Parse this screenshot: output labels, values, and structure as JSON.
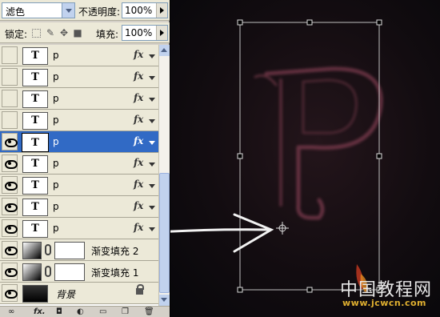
{
  "blend": {
    "mode": "滤色",
    "opacity_label": "不透明度:",
    "opacity_value": "100%"
  },
  "lock": {
    "label": "锁定:",
    "fill_label": "填充:",
    "fill_value": "100%"
  },
  "layers": [
    {
      "name": "p",
      "visible": false,
      "selected": false,
      "type": "text"
    },
    {
      "name": "p",
      "visible": false,
      "selected": false,
      "type": "text"
    },
    {
      "name": "p",
      "visible": false,
      "selected": false,
      "type": "text"
    },
    {
      "name": "p",
      "visible": false,
      "selected": false,
      "type": "text"
    },
    {
      "name": "p",
      "visible": true,
      "selected": true,
      "type": "text"
    },
    {
      "name": "p",
      "visible": true,
      "selected": false,
      "type": "text"
    },
    {
      "name": "p",
      "visible": true,
      "selected": false,
      "type": "text"
    },
    {
      "name": "p",
      "visible": true,
      "selected": false,
      "type": "text"
    },
    {
      "name": "p",
      "visible": true,
      "selected": false,
      "type": "text"
    },
    {
      "name": "渐变填充 2",
      "visible": true,
      "selected": false,
      "type": "gradient-fill"
    },
    {
      "name": "渐变填充 1",
      "visible": true,
      "selected": false,
      "type": "gradient-fill"
    },
    {
      "name": "背景",
      "visible": true,
      "selected": false,
      "type": "background"
    }
  ],
  "text_thumb_glyph": "T",
  "fx_label": "fx",
  "bottom_icons": [
    "link-icon",
    "fx-icon",
    "mask-icon",
    "adjustment-icon",
    "folder-icon",
    "new-layer-icon",
    "trash-icon"
  ],
  "bottom_fx": "fx.",
  "watermark": {
    "main": "中国教程网",
    "url": "www.jcwcn.com"
  },
  "colors": {
    "selection": "#316ac5",
    "panel": "#ece9d8",
    "watermark_url": "#e0b030"
  }
}
